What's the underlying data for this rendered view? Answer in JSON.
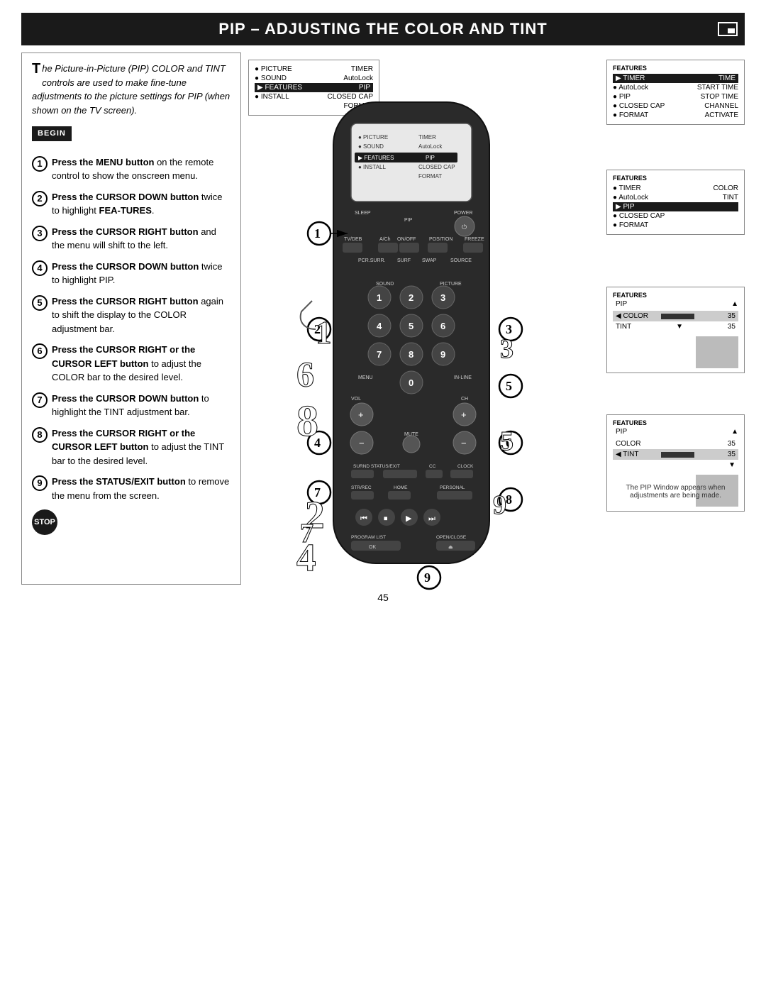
{
  "header": {
    "title": "PIP – Adjusting the Color and Tint"
  },
  "intro": {
    "text": "he Picture-in-Picture (PIP) COLOR and TINT controls are used to make fine-tune adjustments to the picture settings for PIP (when shown on the TV screen).",
    "dropcap": "T",
    "begin_label": "BEGIN",
    "stop_label": "STOP"
  },
  "steps": [
    {
      "num": "1",
      "text": "Press the MENU button on the remote control to show the onscreen menu."
    },
    {
      "num": "2",
      "text": "Press the CURSOR DOWN button twice to highlight FEA-TURES.",
      "bold_parts": [
        "Press the CURSOR DOWN",
        "FEA-TURES"
      ]
    },
    {
      "num": "3",
      "text": "Press the CURSOR RIGHT button and the menu will shift to the left.",
      "bold_parts": [
        "Press the CURSOR RIGHT"
      ]
    },
    {
      "num": "4",
      "text": "Press the CURSOR DOWN button twice to highlight PIP.",
      "bold_parts": [
        "Press the CURSOR DOWN"
      ]
    },
    {
      "num": "5",
      "text": "Press the CURSOR RIGHT button again to shift the display to the COLOR adjustment bar.",
      "bold_parts": [
        "Press the CURSOR RIGHT"
      ]
    },
    {
      "num": "6",
      "text": "Press the CURSOR RIGHT or the CURSOR LEFT button to adjust the COLOR bar to the desired level.",
      "bold_parts": [
        "Press the CURSOR RIGHT or",
        "the CURSOR LEFT button"
      ]
    },
    {
      "num": "7",
      "text": "Press the CURSOR DOWN button to highlight the TINT adjustment bar.",
      "bold_parts": [
        "Press the CURSOR DOWN"
      ]
    },
    {
      "num": "8",
      "text": "Press the CURSOR RIGHT or the CURSOR LEFT button to adjust the TINT bar to the desired level.",
      "bold_parts": [
        "Press the CURSOR RIGHT or",
        "the CURSOR LEFT button"
      ]
    },
    {
      "num": "9",
      "text": "Press the STATUS/EXIT button to remove the menu from the screen.",
      "bold_parts": [
        "Press the STATUS/EXIT but-",
        "ton"
      ]
    }
  ],
  "main_menu": {
    "items": [
      {
        "label": "● PICTURE",
        "right": "TIMER",
        "highlighted": false
      },
      {
        "label": "● SOUND",
        "right": "AutoLock",
        "highlighted": false
      },
      {
        "label": "▶ FEATURES",
        "right": "PIP",
        "highlighted": true
      },
      {
        "label": "● INSTALL",
        "right": "CLOSED CAP",
        "highlighted": false
      },
      {
        "label": "",
        "right": "FORMAT",
        "highlighted": false
      }
    ]
  },
  "features_menu_1": {
    "title": "FEATURES",
    "items": [
      {
        "label": "▶ TIMER",
        "right": "TIME",
        "highlighted": true
      },
      {
        "label": "● AutoLock",
        "right": "START TIME",
        "highlighted": false
      },
      {
        "label": "● PIP",
        "right": "STOP TIME",
        "highlighted": false
      },
      {
        "label": "● CLOSED CAP",
        "right": "CHANNEL",
        "highlighted": false
      },
      {
        "label": "● FORMAT",
        "right": "ACTIVATE",
        "highlighted": false
      }
    ]
  },
  "features_menu_2": {
    "title": "FEATURES",
    "items": [
      {
        "label": "● TIMER",
        "right": "COLOR",
        "highlighted": false
      },
      {
        "label": "● AutoLock",
        "right": "TINT",
        "highlighted": false
      },
      {
        "label": "▶ PIP",
        "right": "",
        "highlighted": true
      },
      {
        "label": "● CLOSED CAP",
        "right": "",
        "highlighted": false
      },
      {
        "label": "● FORMAT",
        "right": "",
        "highlighted": false
      }
    ]
  },
  "pip_color_menu": {
    "title": "FEATURES",
    "subtitle": "PIP",
    "color_label": "◀ COLOR",
    "color_value": 35,
    "color_max": 60,
    "tint_label": "TINT",
    "tint_value": 35
  },
  "pip_tint_menu": {
    "title": "FEATURES",
    "subtitle": "PIP",
    "color_label": "COLOR",
    "color_value": 35,
    "tint_label": "◀ TINT",
    "tint_value": 35
  },
  "pip_caption": "The PIP Window appears when adjustments are being made.",
  "page_number": "45"
}
